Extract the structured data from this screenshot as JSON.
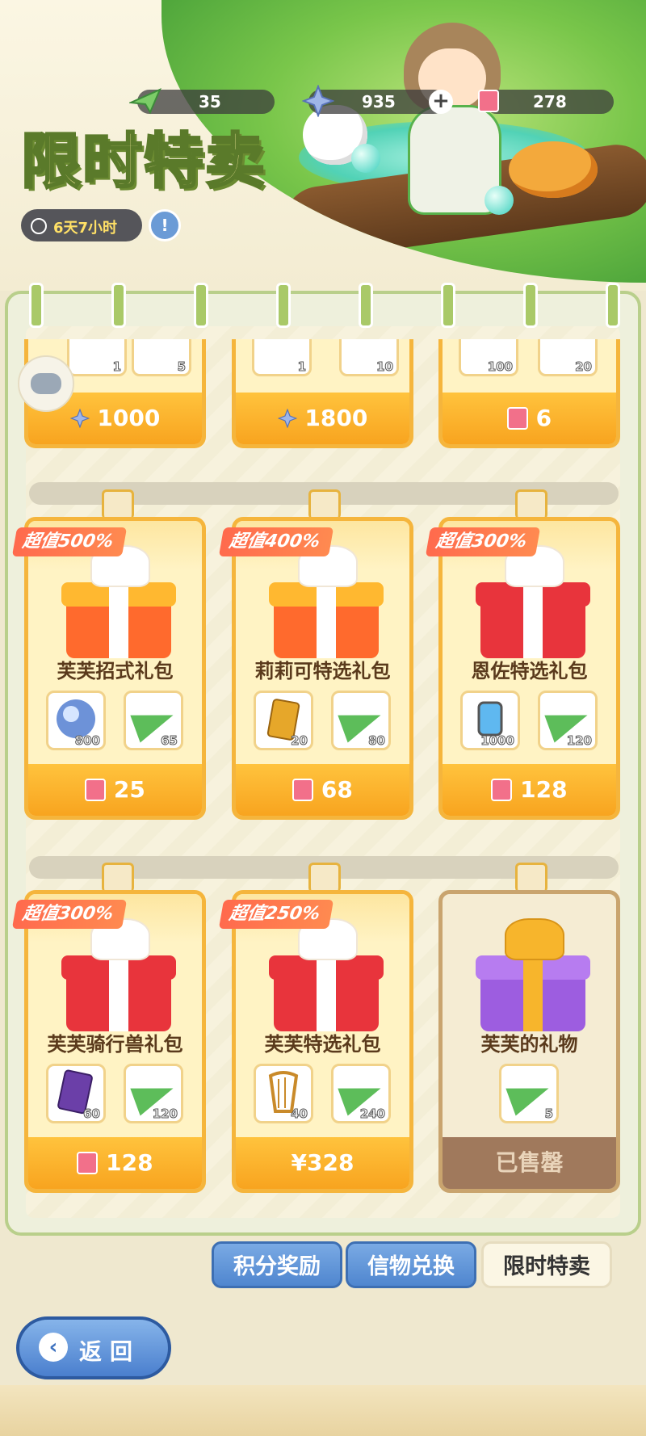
{
  "header": {
    "title": "限时特卖",
    "timer": "6天7小时",
    "currencies": [
      {
        "icon": "paper-plane-icon",
        "value": "35"
      },
      {
        "icon": "star-crystal-icon",
        "value": "935"
      },
      {
        "icon": "ticket-icon",
        "value": "278"
      }
    ]
  },
  "top_row": [
    {
      "price": "1000",
      "currency": "star-crystal-icon",
      "items": [
        "1",
        "5"
      ]
    },
    {
      "price": "1800",
      "currency": "star-crystal-icon",
      "items": [
        "1",
        "10"
      ]
    },
    {
      "price": "6",
      "currency": "ticket-icon",
      "items": [
        "100",
        "20"
      ]
    }
  ],
  "packs": [
    {
      "badge": "超值500%",
      "name": "芙芙招式礼包",
      "items": [
        {
          "icon": "crystal-orb-icon",
          "qty": "800"
        },
        {
          "icon": "paper-plane-icon",
          "qty": "65"
        }
      ],
      "price": "25",
      "currency": "ticket-icon"
    },
    {
      "badge": "超值400%",
      "name": "莉莉可特选礼包",
      "items": [
        {
          "icon": "gold-card-icon",
          "qty": "20"
        },
        {
          "icon": "paper-plane-icon",
          "qty": "80"
        }
      ],
      "price": "68",
      "currency": "ticket-icon"
    },
    {
      "badge": "超值300%",
      "name": "恩佐特选礼包",
      "items": [
        {
          "icon": "blue-potion-icon",
          "qty": "1000"
        },
        {
          "icon": "paper-plane-icon",
          "qty": "120"
        }
      ],
      "price": "128",
      "currency": "ticket-icon"
    },
    {
      "badge": "超值300%",
      "name": "芙芙骑行兽礼包",
      "items": [
        {
          "icon": "purple-card-icon",
          "qty": "60"
        },
        {
          "icon": "paper-plane-icon",
          "qty": "120"
        }
      ],
      "price": "128",
      "currency": "ticket-icon"
    },
    {
      "badge": "超值250%",
      "name": "芙芙特选礼包",
      "items": [
        {
          "icon": "harp-icon",
          "qty": "40"
        },
        {
          "icon": "paper-plane-icon",
          "qty": "240"
        }
      ],
      "price": "¥328",
      "currency": ""
    },
    {
      "badge": "",
      "name": "芙芙的礼物",
      "items": [
        {
          "icon": "paper-plane-icon",
          "qty": "5"
        }
      ],
      "price": "已售罄",
      "currency": ""
    }
  ],
  "tabs": [
    "积分奖励",
    "信物兑换",
    "限时特卖"
  ],
  "back_label": "返回",
  "colors": {
    "accent": "#f5b53c",
    "tab_blue": "#4f86cf",
    "badge": "#ff6a4d"
  }
}
